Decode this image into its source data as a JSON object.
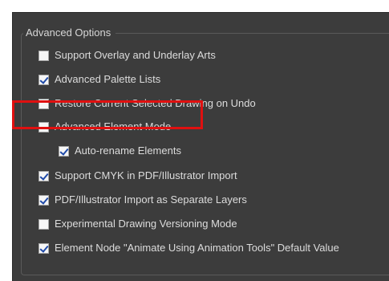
{
  "group": {
    "title": "Advanced Options"
  },
  "options": [
    {
      "label": "Support Overlay and Underlay Arts",
      "checked": false
    },
    {
      "label": "Advanced Palette Lists",
      "checked": true
    },
    {
      "label": "Restore Current Selected Drawing on Undo",
      "checked": false
    },
    {
      "label": "Advanced Element Mode",
      "checked": false
    },
    {
      "label": "Auto-rename Elements",
      "checked": true
    },
    {
      "label": "Support CMYK in PDF/Illustrator Import",
      "checked": true
    },
    {
      "label": "PDF/Illustrator Import as Separate Layers",
      "checked": true
    },
    {
      "label": "Experimental Drawing Versioning Mode",
      "checked": false
    },
    {
      "label": "Element Node \"Animate Using Animation Tools\" Default Value",
      "checked": true
    }
  ],
  "colors": {
    "highlight": "#e01010",
    "panel": "#3c3c3c",
    "check": "#1f4aa8"
  }
}
